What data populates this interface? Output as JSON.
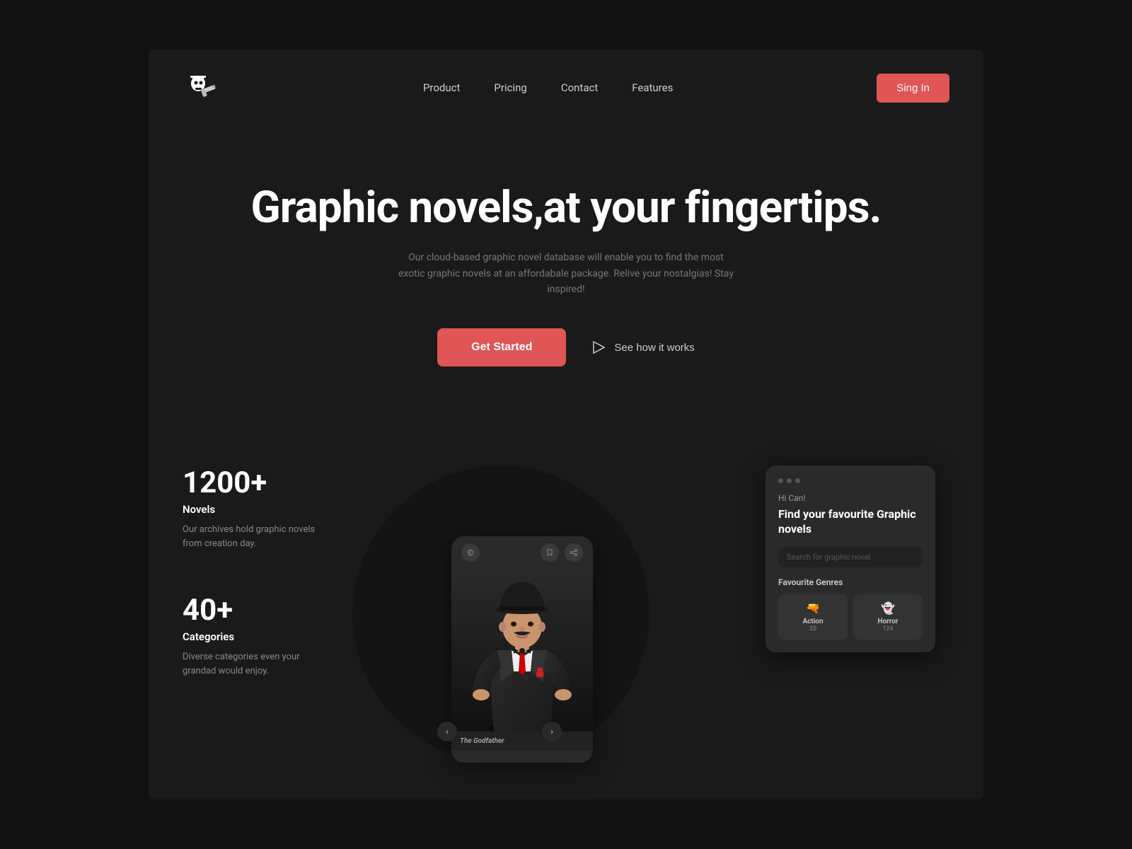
{
  "meta": {
    "bg_outer": "#111111",
    "bg_page": "#1a1a1a",
    "accent": "#e05555"
  },
  "navbar": {
    "logo_alt": "Graphic Novels App",
    "links": [
      {
        "label": "Product",
        "id": "product"
      },
      {
        "label": "Pricing",
        "id": "pricing"
      },
      {
        "label": "Contact",
        "id": "contact"
      },
      {
        "label": "Features",
        "id": "features"
      }
    ],
    "signin_label": "Sing In"
  },
  "hero": {
    "title": "Graphic novels,at your fingertips.",
    "subtitle": "Our cloud-based graphic novel database will enable you to find the most exotic graphic novels at an affordabale package. Relive your nostalgias! Stay inspired!",
    "get_started_label": "Get Started",
    "see_how_label": "See how it works"
  },
  "stats": [
    {
      "number": "1200+",
      "label": "Novels",
      "desc": "Our archives hold graphic novels from creation day."
    },
    {
      "number": "40+",
      "label": "Categories",
      "desc": "Diverse categories even your grandad would enjoy."
    }
  ],
  "app_card": {
    "greeting": "Hi Can!",
    "title": "Find your favourite Graphic novels",
    "search_placeholder": "Search for graphic novel",
    "genres_title": "Favourite Genres",
    "genres": [
      {
        "name": "Action",
        "count": "35",
        "icon": "🔫"
      },
      {
        "name": "Horror",
        "count": "124",
        "icon": "👻"
      }
    ]
  },
  "phone": {
    "book_title": "The Godfather"
  }
}
